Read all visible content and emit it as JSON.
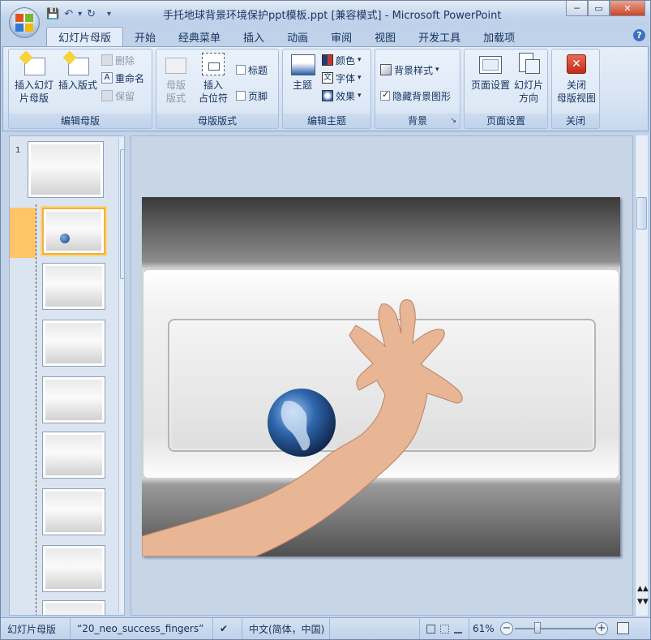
{
  "window": {
    "title": "手托地球背景环境保护ppt模板.ppt [兼容模式] - Microsoft PowerPoint",
    "minimize": "─",
    "restore": "▭",
    "close": "✕"
  },
  "quick_access": {
    "save": "💾",
    "undo": "↶",
    "undo_dropdown": "▾",
    "redo": "↻",
    "customize": "▾"
  },
  "tabs": [
    "幻灯片母版",
    "开始",
    "经典菜单",
    "插入",
    "动画",
    "审阅",
    "视图",
    "开发工具",
    "加载项"
  ],
  "help": "?",
  "ribbon": {
    "groups": {
      "edit_master": {
        "label": "编辑母版",
        "insert_master": "插入幻灯\n片母版",
        "insert_layout": "插入版式",
        "delete": "删除",
        "rename": "重命名",
        "preserve": "保留"
      },
      "master_layout": {
        "label": "母版版式",
        "master_layout_btn": "母版\n版式",
        "insert_placeholder": "插入\n占位符",
        "title_chk": "标题",
        "footer_chk": "页脚"
      },
      "edit_theme": {
        "label": "编辑主题",
        "themes": "主题",
        "colors": "颜色",
        "fonts": "字体",
        "effects": "效果"
      },
      "background": {
        "label": "背景",
        "bg_styles": "背景样式",
        "hide_bg": "隐藏背景图形",
        "hide_bg_checked": true
      },
      "page_setup": {
        "label": "页面设置",
        "page_setup_btn": "页面设置",
        "orientation": "幻灯片\n方向"
      },
      "close": {
        "label": "关闭",
        "close_master": "关闭\n母版视图"
      }
    }
  },
  "thumbnail_pane": {
    "slide_number": "1",
    "selected_index": 1,
    "thumb_count": 9
  },
  "status_bar": {
    "view": "幻灯片母版",
    "theme": "“20_neo_success_fingers”",
    "language": "中文(简体，中国)",
    "zoom": "61%",
    "zoom_minus": "−",
    "zoom_plus": "+"
  },
  "colors": {
    "accent": "#3b71c4",
    "ribbon_bg": "#dde8f6",
    "selected_thumb": "#f0b23d"
  }
}
